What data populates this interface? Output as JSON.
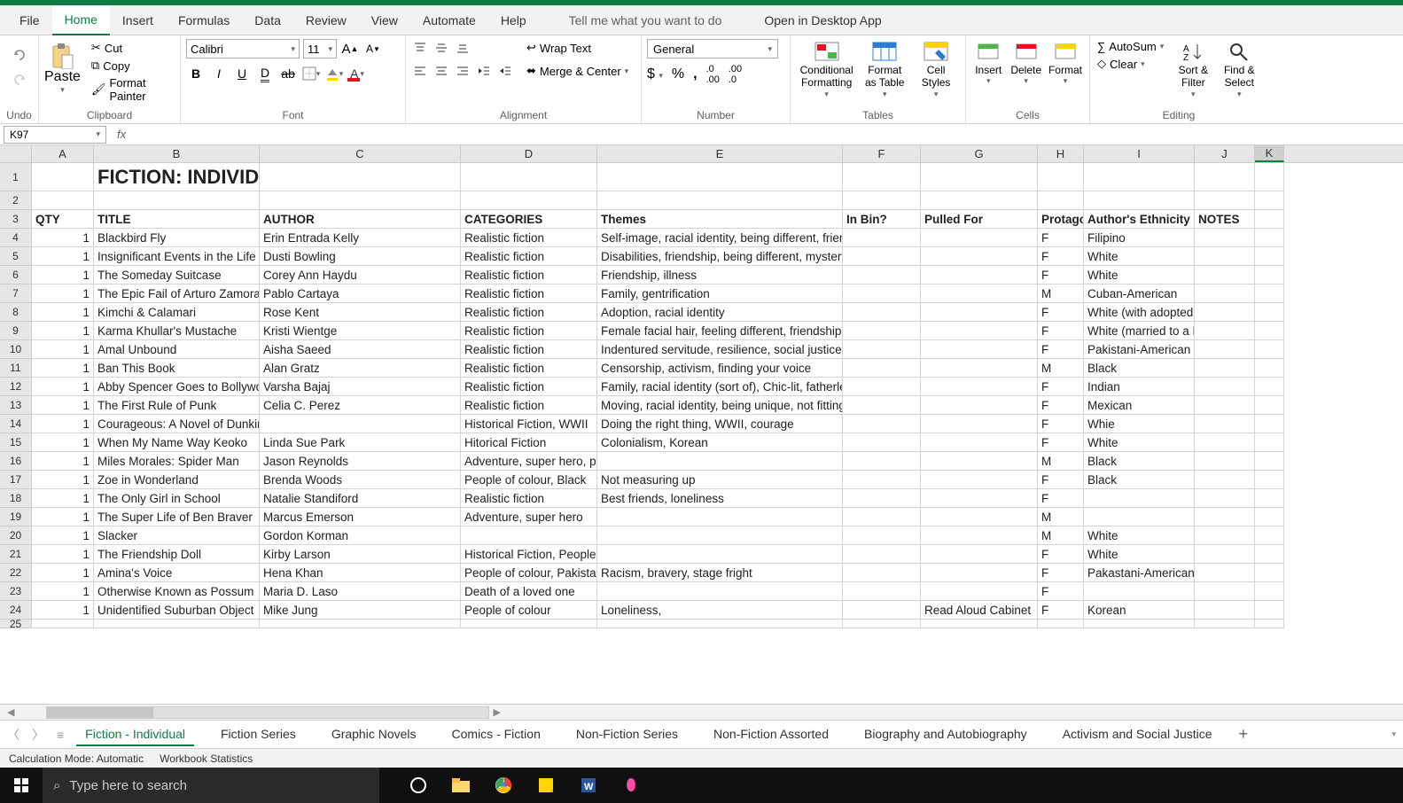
{
  "menu": {
    "tabs": [
      "File",
      "Home",
      "Insert",
      "Formulas",
      "Data",
      "Review",
      "View",
      "Automate",
      "Help"
    ],
    "active_index": 1,
    "tell_me": "Tell me what you want to do",
    "open_desktop": "Open in Desktop App"
  },
  "ribbon": {
    "undo_label": "Undo",
    "clipboard": {
      "paste": "Paste",
      "cut": "Cut",
      "copy": "Copy",
      "format_painter": "Format Painter",
      "label": "Clipboard"
    },
    "font": {
      "name": "Calibri",
      "size": "11",
      "label": "Font"
    },
    "alignment": {
      "wrap": "Wrap Text",
      "merge": "Merge & Center",
      "label": "Alignment"
    },
    "number": {
      "format": "General",
      "label": "Number"
    },
    "tables": {
      "cond": "Conditional Formatting",
      "ftable": "Format as Table",
      "cstyles": "Cell Styles",
      "label": "Tables"
    },
    "cells": {
      "insert": "Insert",
      "delete": "Delete",
      "format": "Format",
      "label": "Cells"
    },
    "editing": {
      "autosum": "AutoSum",
      "clear": "Clear",
      "sort": "Sort & Filter",
      "find": "Find & Select",
      "label": "Editing"
    }
  },
  "namebox": "K97",
  "fx": "fx",
  "columns": [
    "A",
    "B",
    "C",
    "D",
    "E",
    "F",
    "G",
    "H",
    "I",
    "J",
    "K"
  ],
  "selected_col": 10,
  "title_cell": "FICTION: INDIVIDUAL",
  "headers": {
    "qty": "QTY",
    "title": "TITLE",
    "author": "AUTHOR",
    "categories": "CATEGORIES",
    "themes": "Themes",
    "inbin": "In Bin?",
    "pulled": "Pulled For",
    "protagonist": "Protagon",
    "ethnicity": "Author's Ethnicity",
    "notes": "NOTES"
  },
  "rows": [
    {
      "qty": "1",
      "title": "Blackbird Fly",
      "author": "Erin Entrada Kelly",
      "cat": "Realistic fiction",
      "themes": "Self-image, racial identity, being different, friendship, sexism, romantic relations",
      "inbin": "",
      "pulled": "",
      "prot": "F",
      "eth": "Filipino",
      "notes": ""
    },
    {
      "qty": "1",
      "title": "Insignificant Events in the Life",
      "author": "Dusti Bowling",
      "cat": "Realistic fiction",
      "themes": "Disabilities, friendship, being different, mystery",
      "inbin": "",
      "pulled": "",
      "prot": "F",
      "eth": "White",
      "notes": ""
    },
    {
      "qty": "1",
      "title": "The Someday Suitcase",
      "author": "Corey Ann Haydu",
      "cat": "Realistic fiction",
      "themes": "Friendship, illness",
      "inbin": "",
      "pulled": "",
      "prot": "F",
      "eth": "White",
      "notes": ""
    },
    {
      "qty": "1",
      "title": "The Epic Fail of Arturo Zamora",
      "author": "Pablo Cartaya",
      "cat": "Realistic fiction",
      "themes": "Family, gentrification",
      "inbin": "",
      "pulled": "",
      "prot": "M",
      "eth": "Cuban-American",
      "notes": ""
    },
    {
      "qty": "1",
      "title": "Kimchi & Calamari",
      "author": "Rose Kent",
      "cat": "Realistic fiction",
      "themes": "Adoption, racial identity",
      "inbin": "",
      "pulled": "",
      "prot": "F",
      "eth": "White (with adopted Korean kids)",
      "notes": ""
    },
    {
      "qty": "1",
      "title": "Karma Khullar's Mustache",
      "author": "Kristi Wientge",
      "cat": "Realistic fiction",
      "themes": "Female facial hair, feeling different, friendship",
      "inbin": "",
      "pulled": "",
      "prot": "F",
      "eth": "White (married to a Pakistani man)",
      "notes": ""
    },
    {
      "qty": "1",
      "title": "Amal Unbound",
      "author": "Aisha Saeed",
      "cat": "Realistic fiction",
      "themes": "Indentured servitude, resilience, social justice",
      "inbin": "",
      "pulled": "",
      "prot": "F",
      "eth": "Pakistani-American",
      "notes": ""
    },
    {
      "qty": "1",
      "title": "Ban This Book",
      "author": "Alan Gratz",
      "cat": "Realistic fiction",
      "themes": "Censorship, activism, finding your voice",
      "inbin": "",
      "pulled": "",
      "prot": "M",
      "eth": "Black",
      "notes": ""
    },
    {
      "qty": "1",
      "title": "Abby Spencer Goes to Bollywo",
      "author": "Varsha Bajaj",
      "cat": "Realistic fiction",
      "themes": "Family, racial identity (sort of), Chic-lit, fatherless, reunites with dad, celebrity",
      "inbin": "",
      "pulled": "",
      "prot": "F",
      "eth": "Indian",
      "notes": ""
    },
    {
      "qty": "1",
      "title": "The First Rule of Punk",
      "author": "Celia C. Perez",
      "cat": "Realistic fiction",
      "themes": "Moving, racial identity, being unique, not fitting in",
      "inbin": "",
      "pulled": "",
      "prot": "F",
      "eth": "Mexican",
      "notes": ""
    },
    {
      "qty": "1",
      "title": "Courageous: A Novel of Dunkirk",
      "author": "",
      "cat": "Historical Fiction, WWII",
      "themes": "Doing the right thing, WWII, courage",
      "inbin": "",
      "pulled": "",
      "prot": "F",
      "eth": "Whie",
      "notes": ""
    },
    {
      "qty": "1",
      "title": "When My Name Way Keoko",
      "author": "Linda Sue Park",
      "cat": "Hitorical Fiction",
      "themes": "Colonialism, Korean",
      "inbin": "",
      "pulled": "",
      "prot": "F",
      "eth": "White",
      "notes": ""
    },
    {
      "qty": "1",
      "title": "Miles Morales: Spider Man",
      "author": "Jason Reynolds",
      "cat": "Adventure, super hero, people of colour",
      "themes": "",
      "inbin": "",
      "pulled": "",
      "prot": "M",
      "eth": "Black",
      "notes": ""
    },
    {
      "qty": "1",
      "title": "Zoe in Wonderland",
      "author": "Brenda Woods",
      "cat": "People of colour,  Black",
      "themes": "Not measuring up",
      "inbin": "",
      "pulled": "",
      "prot": "F",
      "eth": "Black",
      "notes": ""
    },
    {
      "qty": "1",
      "title": "The Only Girl in School",
      "author": "Natalie Standiford",
      "cat": "Realistic fiction",
      "themes": "Best friends, loneliness",
      "inbin": "",
      "pulled": "",
      "prot": "F",
      "eth": "",
      "notes": ""
    },
    {
      "qty": "1",
      "title": "The Super Life of Ben Braver",
      "author": "Marcus Emerson",
      "cat": "Adventure, super hero",
      "themes": "",
      "inbin": "",
      "pulled": "",
      "prot": "M",
      "eth": "",
      "notes": ""
    },
    {
      "qty": "1",
      "title": "Slacker",
      "author": "Gordon Korman",
      "cat": "",
      "themes": "",
      "inbin": "",
      "pulled": "",
      "prot": "M",
      "eth": "White",
      "notes": ""
    },
    {
      "qty": "1",
      "title": "The Friendship Doll",
      "author": "Kirby Larson",
      "cat": "Historical Fiction, People of colour (sort of…a Japanese doll)",
      "themes": "",
      "inbin": "",
      "pulled": "",
      "prot": "F",
      "eth": "White",
      "notes": ""
    },
    {
      "qty": "1",
      "title": "Amina's Voice",
      "author": "Hena Khan",
      "cat": "People of colour, Pakista",
      "themes": "Racism, bravery, stage fright",
      "inbin": "",
      "pulled": "",
      "prot": "F",
      "eth": "Pakastani-American",
      "notes": ""
    },
    {
      "qty": "1",
      "title": "Otherwise Known as Possum",
      "author": "Maria D. Laso",
      "cat": "Death of a loved one",
      "themes": "",
      "inbin": "",
      "pulled": "",
      "prot": "F",
      "eth": "",
      "notes": ""
    },
    {
      "qty": "1",
      "title": "Unidentified Suburban Object",
      "author": "Mike Jung",
      "cat": "People of colour",
      "themes": "Loneliness,",
      "inbin": "",
      "pulled": "Read Aloud Cabinet",
      "prot": "F",
      "eth": "Korean",
      "notes": ""
    }
  ],
  "sheet_tabs": [
    "Fiction - Individual",
    "Fiction Series",
    "Graphic Novels",
    "Comics - Fiction",
    "Non-Fiction Series",
    "Non-Fiction Assorted",
    "Biography and Autobiography",
    "Activism and Social Justice"
  ],
  "active_sheet": 0,
  "status": {
    "calc": "Calculation Mode: Automatic",
    "wb": "Workbook Statistics"
  },
  "taskbar": {
    "search": "Type here to search"
  }
}
